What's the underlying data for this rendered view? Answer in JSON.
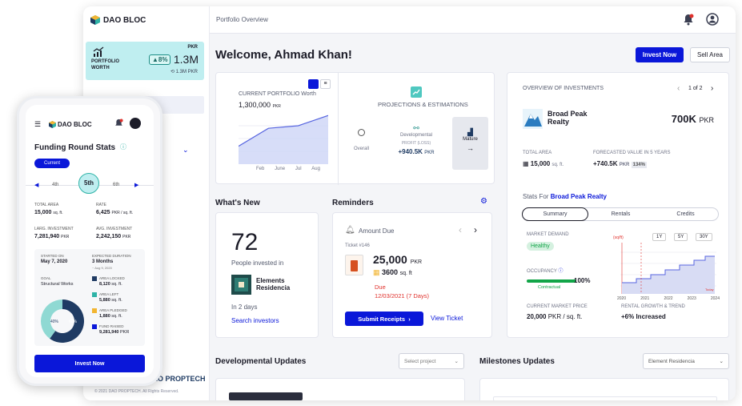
{
  "brand": {
    "name": "DAO BLOC"
  },
  "sidebar": {
    "currency": "PKR",
    "portfolio_label_1": "PORTFOLIO",
    "portfolio_label_2": "WORTH",
    "change": "8%",
    "value": "1.3M",
    "sub_value": "1.3M PKR",
    "footer": "© 2021 DAO PROPTECH. All Rights Reserved."
  },
  "header": {
    "breadcrumb": "Portfolio Overview"
  },
  "welcome": "Welcome, Ahmad Khan!",
  "actions": {
    "invest_now": "Invest Now",
    "sell_area": "Sell Area"
  },
  "portfolio_card": {
    "label": "CURRENT PORTFOLIO Worth",
    "value": "1,300,000",
    "unit": "PKR",
    "months": [
      "Feb",
      "June",
      "Jul",
      "Aug"
    ],
    "projections": "PROJECTIONS & ESTIMATIONS",
    "overall": "Overall",
    "developmental": "Developmental",
    "profit_label": "PROFIT (LOSS)",
    "profit_value": "+940.5",
    "profit_unit": "K",
    "profit_currency": "PKR",
    "mature": "Mature"
  },
  "chart_data": {
    "type": "area",
    "x": [
      "Feb",
      "June",
      "Jul",
      "Aug"
    ],
    "values": [
      35,
      70,
      75,
      95
    ],
    "title": "",
    "xlabel": "",
    "ylabel": ""
  },
  "overview": {
    "title": "OVERVIEW OF INVESTMENTS",
    "pagination": "1 of 2",
    "project_line1": "Broad Peak",
    "project_line2": "Realty",
    "amount": "700K",
    "currency": "PKR",
    "total_area_label": "TOTAL AREA",
    "total_area_value": "15,000",
    "total_area_unit": "sq. ft.",
    "forecast_label": "FORECASTED VALUE IN 5 YEARS",
    "forecast_value": "+740.5K",
    "forecast_unit": "PKR",
    "forecast_pct": "134%",
    "stats_prefix": "Stats For",
    "stats_project": "Broad Peak Realty",
    "tabs": [
      "Summary",
      "Rentals",
      "Credits"
    ],
    "market_demand_label": "MARKET DEMAND",
    "market_demand_value": "Healthy",
    "occupancy_label": "OCCUPANCY",
    "occupancy_sub": "Contractual",
    "occupancy_value": "100%",
    "price_label": "CURRENT MARKET PRICE",
    "price_value": "20,000",
    "price_unit": "PKR / sq. ft.",
    "rental_label": "RENTAL GROWTH & TREND",
    "rental_value": "+6% Increased",
    "chart_tabs": [
      "1Y",
      "5Y",
      "30Y"
    ],
    "chart_years": [
      "2020",
      "2021",
      "2022",
      "2023",
      "2024"
    ],
    "chart_ylab": "(sq/ft)",
    "chart_today": "Today"
  },
  "whats_new": {
    "title": "What's New",
    "count": "72",
    "caption": "People invested in",
    "project_line1": "Elements",
    "project_line2": "Residencia",
    "duration": "In 2 days",
    "link": "Search investors"
  },
  "reminders": {
    "title": "Reminders",
    "type": "Amount Due",
    "ticket": "Ticket #146",
    "amount": "25,000",
    "amount_unit": "PKR",
    "area": "3600",
    "area_unit": "sq. ft",
    "due_label": "Due",
    "due_date": "12/03/2021 (7 Days)",
    "submit": "Submit Receipts",
    "view": "View Ticket"
  },
  "dev_updates": {
    "title": "Developmental Updates",
    "select": "Select project"
  },
  "milestones": {
    "title": "Milestones Updates",
    "select": "Element Residencia"
  },
  "mobile": {
    "brand": "DAO BLOC",
    "title": "Funding Round Stats",
    "current": "Current",
    "steps": [
      "4th",
      "5th",
      "6th"
    ],
    "total_area_label": "TOTAL AREA",
    "total_area_value": "15,000",
    "total_area_unit": "sq. ft.",
    "rate_label": "RATE",
    "rate_value": "6,425",
    "rate_unit": "PKR / sq. ft.",
    "larg_label": "LARG. INVESTMENT",
    "larg_value": "7,281,940",
    "larg_unit": "PKR",
    "avg_label": "AVG. INVESTMENT",
    "avg_value": "2,242,150",
    "avg_unit": "PKR",
    "started_label": "STARTED ON",
    "started_value": "May 7, 2020",
    "expected_label": "EXPECTED DURATION",
    "expected_value": "3 Months",
    "expected_sub": "~ Aug 9, 2020",
    "goal_label": "GOAL",
    "goal_value": "Structural Works",
    "locked_label": "AREA LOCKED",
    "locked_value": "8,120",
    "locked_unit": "sq. ft.",
    "left_label": "AREA LEFT",
    "left_value": "5,880",
    "left_unit": "sq. ft.",
    "pledged_label": "AREA PLEDGED",
    "pledged_value": "1,880",
    "pledged_unit": "sq. ft.",
    "fund_label": "FUND RAISED",
    "fund_value": "9,281,940",
    "fund_unit": "PKR",
    "donut": [
      {
        "label": "60%",
        "value": 60,
        "color": "#1f3b63"
      },
      {
        "label": "40%",
        "value": 40,
        "color": "#8fd9d3"
      }
    ],
    "invest": "Invest Now"
  },
  "colors": {
    "accent": "#0a17d9",
    "teal": "#bfeef0",
    "green": "#12a548",
    "red": "#e0312c"
  }
}
